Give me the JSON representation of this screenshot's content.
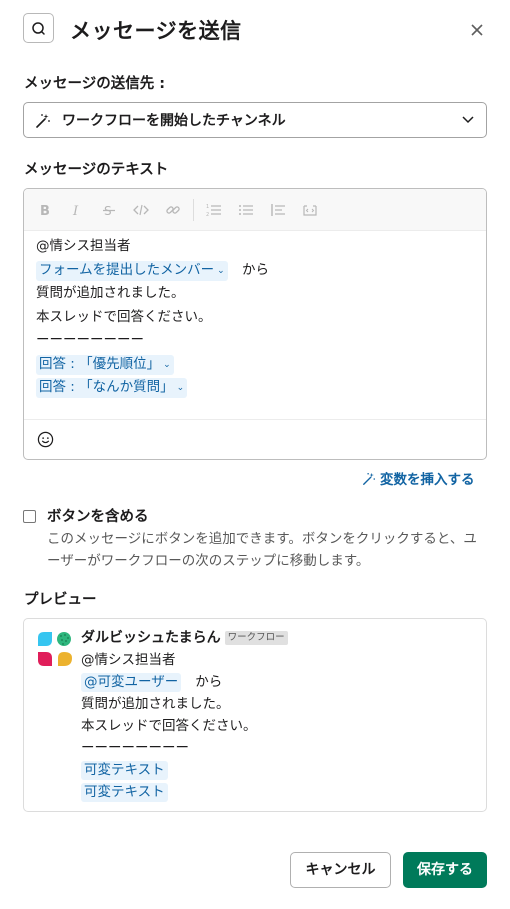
{
  "dialog": {
    "title": "メッセージを送信"
  },
  "recipient": {
    "label": "メッセージの送信先 :",
    "selected_value": "ワークフローを開始したチャンネル"
  },
  "message_text": {
    "label": "メッセージのテキスト",
    "toolbar_icons": [
      "bold-icon",
      "italic-icon",
      "strikethrough-icon",
      "code-icon",
      "link-icon",
      "numbered-list-icon",
      "bulleted-list-icon",
      "quote-icon",
      "code-block-icon"
    ],
    "lines": {
      "l1": "@情シス担当者",
      "l2_pill": "フォームを提出したメンバー",
      "l2_text": "から",
      "l3": "質問が追加されました。",
      "l4": "本スレッドで回答ください。",
      "l5": "ーーーーーーーー",
      "l6_pill": "回答 : 「優先順位」",
      "l7_pill": "回答 : 「なんか質問」"
    }
  },
  "insert_variable": {
    "label": "変数を挿入する"
  },
  "include_button": {
    "label": "ボタンを含める",
    "checked": false,
    "description": "このメッセージにボタンを追加できます。ボタンをクリックすると、ユーザーがワークフローの次のステップに移動します。"
  },
  "preview": {
    "label": "プレビュー",
    "sender_name": "ダルビッシュたまらん",
    "badge": "ワークフロー",
    "lines": {
      "l1": "@情シス担当者",
      "l2_pill": "@可変ユーザー",
      "l2_text": "から",
      "l3": "質問が追加されました。",
      "l4": "本スレッドで回答ください。",
      "l5": "ーーーーーーーー",
      "l6_pill": "可変テキスト",
      "l7_pill": "可変テキスト"
    }
  },
  "footer": {
    "cancel_label": "キャンセル",
    "save_label": "保存する"
  },
  "colors": {
    "primary_green": "#007a5a",
    "link_blue": "#1264a3",
    "pill_bg": "#e8f3fc"
  }
}
